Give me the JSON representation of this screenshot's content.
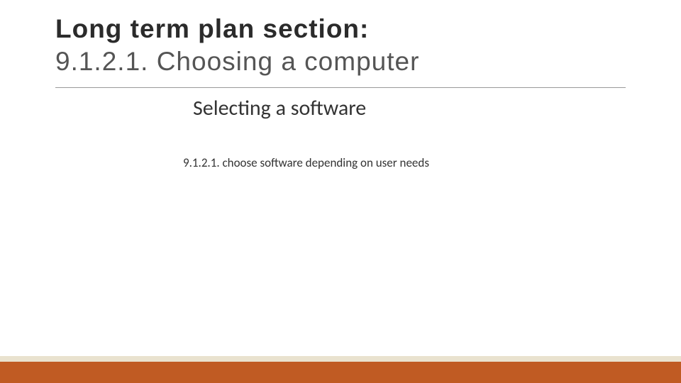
{
  "header": {
    "label_bold": "Long term plan section:",
    "label_light": "9.1.2.1. Choosing a computer"
  },
  "subtitle": "Selecting a software",
  "body": "9.1.2.1. choose software depending on user needs",
  "colors": {
    "accent_orange": "#c05b23",
    "accent_beige": "#e9e2cf",
    "divider": "#9a9a9a"
  }
}
